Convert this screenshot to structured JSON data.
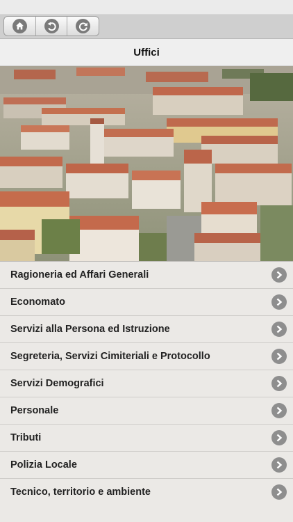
{
  "toolbar": {
    "buttons": [
      {
        "icon": "home-icon"
      },
      {
        "icon": "back-arrow-icon"
      },
      {
        "icon": "refresh-icon"
      }
    ]
  },
  "header": {
    "title": "Uffici"
  },
  "hero": {
    "image": "aerial-town-photo"
  },
  "offices": [
    {
      "label": "Ragioneria ed Affari Generali"
    },
    {
      "label": "Economato"
    },
    {
      "label": "Servizi alla Persona ed Istruzione"
    },
    {
      "label": "Segreteria, Servizi Cimiteriali e Protocollo"
    },
    {
      "label": "Servizi Demografici"
    },
    {
      "label": "Personale"
    },
    {
      "label": "Tributi"
    },
    {
      "label": "Polizia Locale"
    },
    {
      "label": "Tecnico, territorio e ambiente"
    }
  ]
}
